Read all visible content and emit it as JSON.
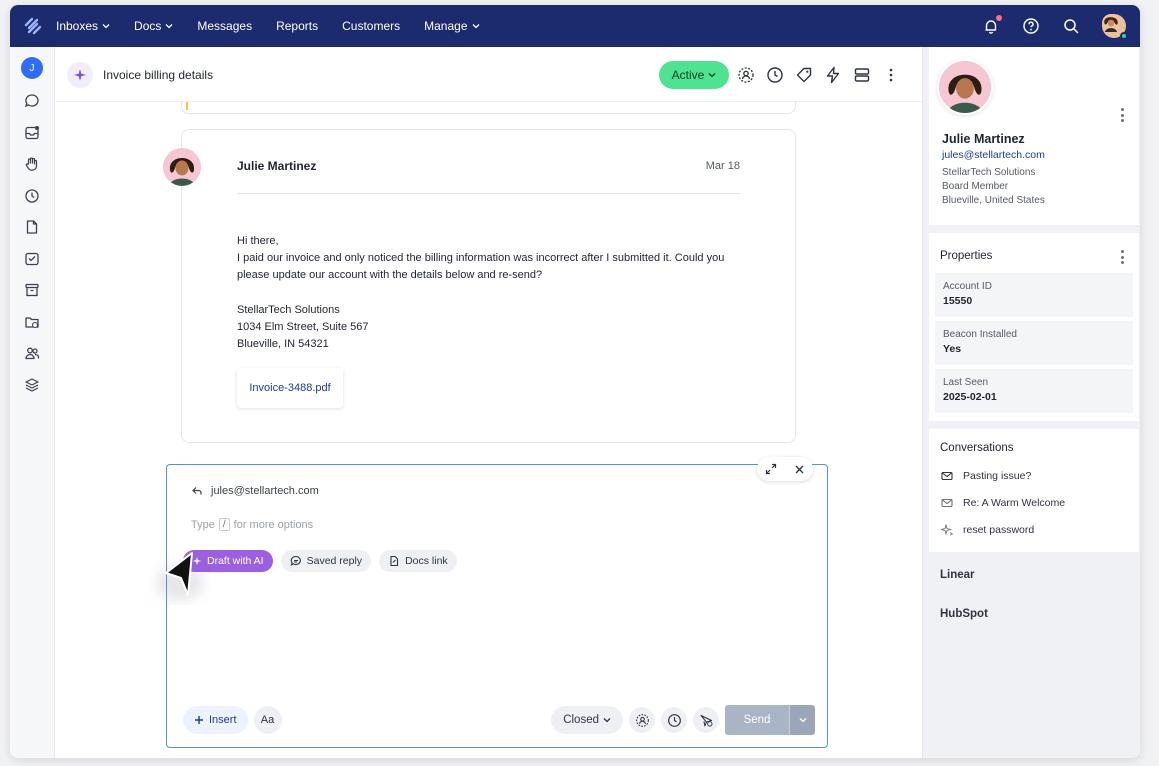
{
  "nav": {
    "items": [
      {
        "label": "Inboxes",
        "dropdown": true
      },
      {
        "label": "Docs",
        "dropdown": true
      },
      {
        "label": "Messages",
        "dropdown": false
      },
      {
        "label": "Reports",
        "dropdown": false
      },
      {
        "label": "Customers",
        "dropdown": false
      },
      {
        "label": "Manage",
        "dropdown": true
      }
    ]
  },
  "rail": {
    "user_initial": "J"
  },
  "header": {
    "title": "Invoice billing details",
    "status": "Active"
  },
  "message": {
    "sender": "Julie Martinez",
    "date": "Mar 18",
    "greeting": "Hi there,",
    "body": "I paid our invoice and only noticed the billing information was  incorrect after I submitted it. Could you please update our account with the details below and re-send?",
    "address_company": "StellarTech Solutions",
    "address_street": "1034 Elm Street, Suite 567",
    "address_city": "Blueville, IN 54321",
    "attachment": "Invoice-3488.pdf"
  },
  "composer": {
    "to": "jules@stellartech.com",
    "placeholder_before": "Type",
    "placeholder_key": "/",
    "placeholder_after": "for more options",
    "chip_ai": "Draft with AI",
    "chip_saved": "Saved reply",
    "chip_docs": "Docs link",
    "insert": "Insert",
    "format": "Aa",
    "status": "Closed",
    "send": "Send"
  },
  "sidebar": {
    "profile": {
      "name": "Julie Martinez",
      "email": "jules@stellartech.com",
      "company": "StellarTech Solutions",
      "role": "Board Member",
      "location": "Blueville, United States"
    },
    "properties": {
      "title": "Properties",
      "items": [
        {
          "label": "Account ID",
          "value": "15550"
        },
        {
          "label": "Beacon Installed",
          "value": "Yes"
        },
        {
          "label": "Last Seen",
          "value": "2025-02-01"
        }
      ]
    },
    "conversations": {
      "title": "Conversations",
      "items": [
        {
          "label": "Pasting issue?",
          "icon": "envelope-icon"
        },
        {
          "label": "Re: A Warm Welcome",
          "icon": "envelope-icon"
        },
        {
          "label": "reset password",
          "icon": "sparkle-icon"
        }
      ]
    },
    "apps": [
      "Linear",
      "HubSpot"
    ]
  },
  "colors": {
    "nav_bg": "#1c2a6e",
    "active_green": "#4ee391",
    "ai_purple": "#9b5fe0",
    "link_blue": "#1c3a9c",
    "composer_border": "#5a8dee"
  }
}
